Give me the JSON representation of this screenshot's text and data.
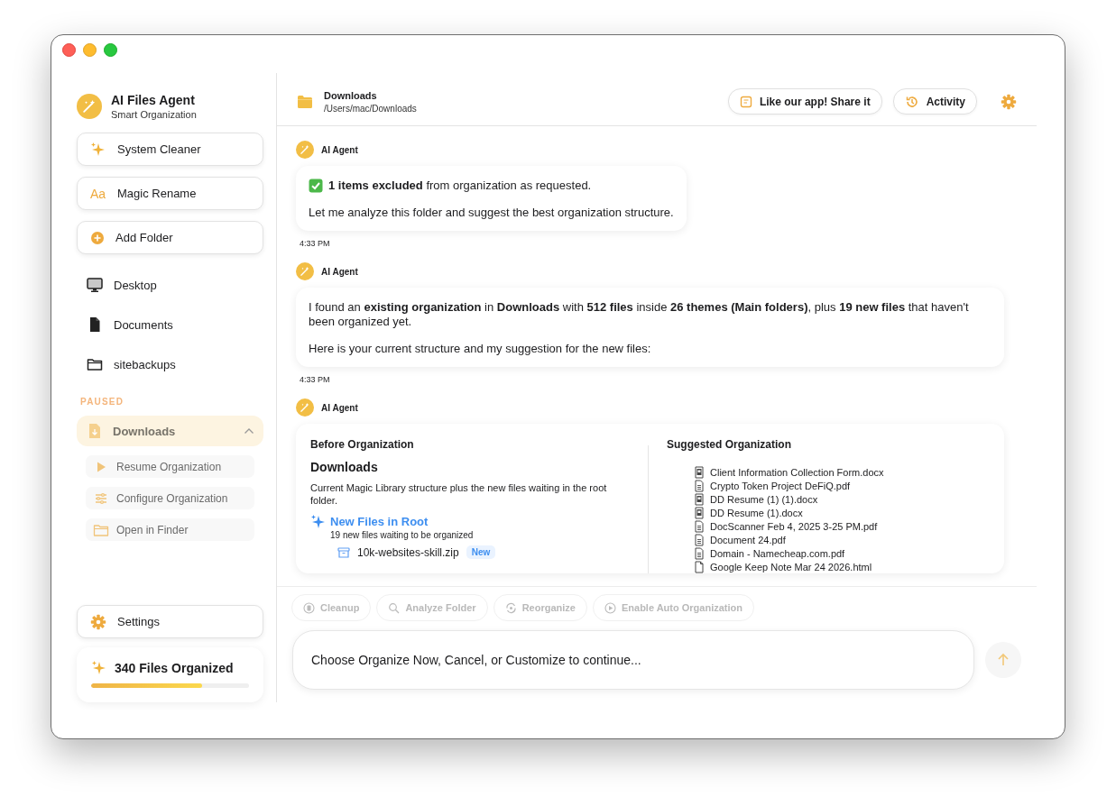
{
  "sidebar": {
    "app": {
      "title": "AI Files Agent",
      "subtitle": "Smart Organization"
    },
    "actions": [
      {
        "label": "System Cleaner"
      },
      {
        "label": "Magic Rename",
        "icon_text": "Aa"
      },
      {
        "label": "Add Folder"
      }
    ],
    "folders": [
      {
        "label": "Desktop",
        "kind": "desktop"
      },
      {
        "label": "Documents",
        "kind": "document"
      },
      {
        "label": "sitebackups",
        "kind": "folder"
      }
    ],
    "paused": {
      "heading": "PAUSED",
      "folder": {
        "label": "Downloads",
        "expanded": true
      },
      "options": [
        {
          "label": "Resume Organization",
          "kind": "play"
        },
        {
          "label": "Configure Organization",
          "kind": "sliders"
        },
        {
          "label": "Open in Finder",
          "kind": "folder"
        }
      ]
    },
    "settings": "Settings",
    "progress": {
      "label": "340 Files Organized",
      "level": 0.7
    }
  },
  "header": {
    "title": "Downloads",
    "path": "/Users/mac/Downloads",
    "buttons": [
      {
        "label": "Like our app! Share it",
        "kind": "share"
      },
      {
        "label": "Activity",
        "kind": "history"
      }
    ]
  },
  "messages": [
    {
      "kind": "text",
      "sender": "AI Agent",
      "paragraphs": [
        {
          "text": "**1 items excluded** from organization as requested.",
          "kind": "confirmation"
        },
        {
          "text": "Let me analyze this folder and suggest the best organization structure.",
          "kind": "plain"
        }
      ],
      "time": "4:33 PM"
    },
    {
      "kind": "text",
      "sender": "AI Agent",
      "paragraphs": [
        {
          "text": "I found an **existing organization** in **Downloads** with **512 files** inside **26 themes (Main folders)**, plus **19 new files** that haven't been organized yet.",
          "kind": "plain"
        },
        {
          "text": "Here is your current structure and my suggestion for the new files:",
          "kind": "plain"
        }
      ],
      "time": "4:33 PM"
    },
    {
      "kind": "organization",
      "sender": "AI Agent",
      "before": {
        "heading": "Before Organization",
        "folder": "Downloads",
        "description": "Current Magic Library structure plus the new files waiting in the root folder.",
        "group": {
          "title": "New Files in Root",
          "subtitle": "19 new files waiting to be organized",
          "files": [
            {
              "name": "10k-websites-skill.zip",
              "badge": "New"
            }
          ]
        }
      },
      "after": {
        "heading": "Suggested Organization",
        "files": [
          {
            "name": "Client Information Collection Form.docx",
            "kind": "docx"
          },
          {
            "name": "Crypto Token Project DeFiQ.pdf",
            "kind": "pdf"
          },
          {
            "name": "DD Resume (1) (1).docx",
            "kind": "docx"
          },
          {
            "name": "DD Resume (1).docx",
            "kind": "docx"
          },
          {
            "name": "DocScanner Feb 4, 2025 3-25 PM.pdf",
            "kind": "pdf"
          },
          {
            "name": "Document 24.pdf",
            "kind": "pdf"
          },
          {
            "name": "Domain - Namecheap.com.pdf",
            "kind": "pdf"
          },
          {
            "name": "Google Keep Note Mar 24 2026.html",
            "kind": "html"
          }
        ]
      }
    }
  ],
  "quick_actions": [
    {
      "label": "Cleanup",
      "kind": "cleanup",
      "disabled": true
    },
    {
      "label": "Analyze Folder",
      "kind": "search",
      "disabled": true
    },
    {
      "label": "Reorganize",
      "kind": "reorganize",
      "disabled": true
    },
    {
      "label": "Enable Auto Organization",
      "kind": "play",
      "disabled": true
    }
  ],
  "composer": {
    "placeholder": "Choose Organize Now, Cancel, or Customize to continue..."
  }
}
